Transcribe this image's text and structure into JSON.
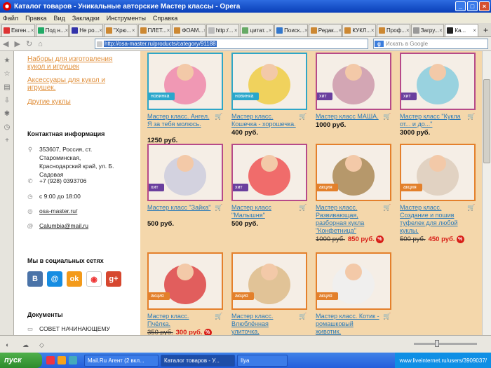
{
  "window": {
    "title": "Каталог товаров - Уникальные авторские Мастер классы - Opera"
  },
  "menu": [
    "Файл",
    "Правка",
    "Вид",
    "Закладки",
    "Инструменты",
    "Справка"
  ],
  "tabs": [
    {
      "label": "Евген...",
      "color": "#d33"
    },
    {
      "label": "Под н...",
      "color": "#2a6"
    },
    {
      "label": "Не ро...",
      "color": "#33a"
    },
    {
      "label": "\"Хрю...",
      "color": "#c83"
    },
    {
      "label": "ПЛЕТ...",
      "color": "#c83"
    },
    {
      "label": "ФОАМ...",
      "color": "#c83"
    },
    {
      "label": "http:/...",
      "color": "#bbb"
    },
    {
      "label": "цитат...",
      "color": "#6a6"
    },
    {
      "label": "Поиск...",
      "color": "#37c"
    },
    {
      "label": "Редак...",
      "color": "#c83"
    },
    {
      "label": "КУКЛ...",
      "color": "#c83"
    },
    {
      "label": "Проф...",
      "color": "#c83"
    },
    {
      "label": "Загру...",
      "color": "#999"
    },
    {
      "label": "Ка...",
      "color": "#222"
    }
  ],
  "address": {
    "url": "http://osa-master.ru/products/category/91188",
    "search_placeholder": "Искать в Google"
  },
  "sidebar": {
    "categories": [
      "Наборы для изготовления кукол и игрушек",
      "Аксессуары для кукол и игрушек.",
      "Другие куклы"
    ],
    "contact_heading": "Контактная информация",
    "address": "353607, Россия, ст. Староминская, Краснодарский край, ул. Б. Садовая",
    "phone": "+7 (928) 0393706",
    "hours": "с 9:00 до 18:00",
    "site": "osa-master.ru/",
    "email": "Calumbia@mail.ru",
    "social_heading": "Мы в социальных сетях",
    "docs_heading": "Документы",
    "doc_item": "СОВЕТ НАЧИНАЮЩЕМУ"
  },
  "products": [
    {
      "title": "Мастер класс. Ангел. Я за тебя молюсь.",
      "badge": "новинка",
      "badge_type": "new",
      "price": "1250 руб.",
      "color": "#e8a",
      "border": "t"
    },
    {
      "title": "Мастер класс. Кошечка - хорошечка.",
      "badge": "новинка",
      "badge_type": "new",
      "price": "400 руб.",
      "color": "#ec4",
      "border": "t"
    },
    {
      "title": "Мастер класс МАША.",
      "badge": "хит",
      "badge_type": "hit",
      "price": "1000 руб.",
      "color": "#c9a",
      "border": ""
    },
    {
      "title": "Мастер класс \"Кукла от... и до...\"",
      "badge": "хит",
      "badge_type": "hit",
      "price": "3000 руб.",
      "color": "#8cd",
      "border": ""
    },
    {
      "title": "Мастер класс \"Зайка\"",
      "badge": "хит",
      "badge_type": "hit",
      "price": "500 руб.",
      "color": "#ccd",
      "border": ""
    },
    {
      "title": "Мастер класс \"Малышня\"",
      "badge": "хит",
      "badge_type": "hit",
      "price": "500 руб.",
      "color": "#e55",
      "border": ""
    },
    {
      "title": "Мастер класс. Развивающая, разборная кукла \"Конфетница\"",
      "badge": "акция",
      "badge_type": "sale",
      "old_price": "1000 руб.",
      "price": "850 руб.",
      "pct": "%",
      "color": "#a85",
      "border": "o"
    },
    {
      "title": "Мастер класс. Создание и пошив туфелек для любой куклы.",
      "badge": "акция",
      "badge_type": "sale",
      "old_price": "500 руб.",
      "price": "450 руб.",
      "pct": "%",
      "color": "#dcb",
      "border": "o"
    },
    {
      "title": "Мастер класс. Пчёлка.",
      "badge": "акция",
      "badge_type": "sale",
      "old_price": "350 руб.",
      "price": "300 руб.",
      "pct": "%",
      "color": "#d44",
      "border": "o"
    },
    {
      "title": "Мастер класс. Влюблённая улиточка.",
      "badge": "акция",
      "badge_type": "sale",
      "price": "",
      "color": "#db8",
      "border": "o"
    },
    {
      "title": "Мастер класс. Котик - ромашковый животик.",
      "badge": "акция",
      "badge_type": "sale",
      "price": "",
      "color": "#eee",
      "border": "o"
    }
  ],
  "taskbar": {
    "start": "пуск",
    "items": [
      "Mail.Ru Агент (2 вкл...",
      "Каталог товаров - У...",
      "Ilya"
    ],
    "tray": "www.liveinternet.ru/users/3909037/"
  }
}
